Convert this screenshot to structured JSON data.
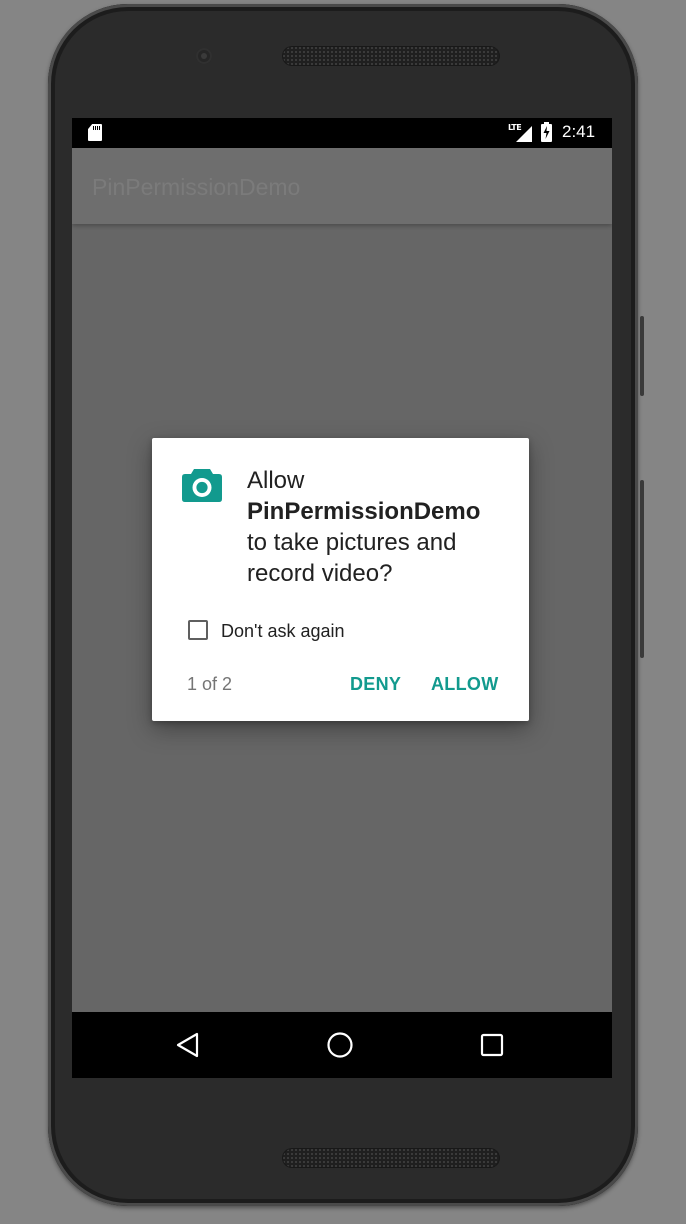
{
  "status_bar": {
    "network_type": "LTE",
    "time": "2:41"
  },
  "app_bar": {
    "title": "PinPermissionDemo"
  },
  "permission_dialog": {
    "icon": "camera-icon",
    "message_prefix": "Allow",
    "app_name": "PinPermissionDemo",
    "message_line_1": "to take pictures and",
    "message_line_2": "record video?",
    "checkbox_label": "Don't ask again",
    "checkbox_checked": false,
    "page_indicator": "1 of 2",
    "deny_label": "DENY",
    "allow_label": "ALLOW",
    "accent_color": "#129a8e"
  },
  "nav_bar": {
    "icons": [
      "back-icon",
      "home-icon",
      "recents-icon"
    ]
  }
}
